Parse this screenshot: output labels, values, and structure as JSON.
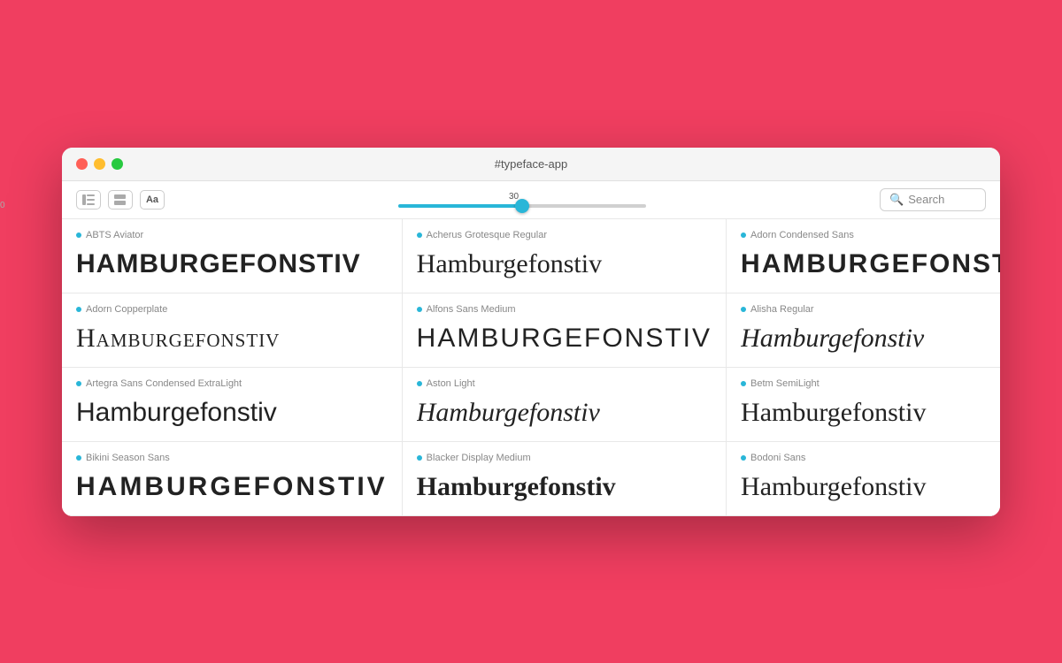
{
  "window": {
    "title": "#typeface-app",
    "traffic_lights": {
      "red": "red",
      "yellow": "yellow",
      "green": "green"
    }
  },
  "toolbar": {
    "icons": [
      {
        "id": "sidebar-icon",
        "symbol": "⊞"
      },
      {
        "id": "grid-icon",
        "symbol": "⊟"
      },
      {
        "id": "font-size-icon",
        "symbol": "Aa"
      }
    ],
    "slider": {
      "value": 30,
      "min": 0,
      "max": 60,
      "label_top": "30",
      "label_bottom": "0"
    },
    "search": {
      "placeholder": "Search",
      "icon": "🔍"
    }
  },
  "fonts": [
    {
      "name": "ABTS Aviator",
      "preview": "Hamburgefonstiv",
      "style": "font-abts"
    },
    {
      "name": "Acherus Grotesque Regular",
      "preview": "Hamburgefonstiv",
      "style": "font-acherus"
    },
    {
      "name": "Adorn Condensed Sans",
      "preview": "HAMBURGEFONSTIV",
      "style": "font-adorn-condensed"
    },
    {
      "name": "Adorn Copperplate",
      "preview": "Hamburgefonstiv",
      "style": "font-adorn-copperplate"
    },
    {
      "name": "Alfons Sans Medium",
      "preview": "HAMBURGEFONSTIV",
      "style": "font-alfons"
    },
    {
      "name": "Alisha Regular",
      "preview": "Hamburgefonstiv",
      "style": "font-alisha"
    },
    {
      "name": "Artegra Sans Condensed ExtraLight",
      "preview": "Hamburgefonstiv",
      "style": "font-artegra"
    },
    {
      "name": "Aston Light",
      "preview": "Hamburgefonstiv",
      "style": "font-aston"
    },
    {
      "name": "Betm SemiLight",
      "preview": "Hamburgefonstiv",
      "style": "font-betm"
    },
    {
      "name": "Bikini Season Sans",
      "preview": "HAMBURGEFONSTIV",
      "style": "font-bikini"
    },
    {
      "name": "Blacker Display Medium",
      "preview": "Hamburgefonstiv",
      "style": "font-blacker"
    },
    {
      "name": "Bodoni Sans",
      "preview": "Hamburgefonstiv",
      "style": "font-bodoni"
    }
  ],
  "colors": {
    "dot_color": "#29b6d8",
    "accent": "#29b6d8",
    "background": "#f03e60",
    "window_bg": "#ffffff"
  }
}
